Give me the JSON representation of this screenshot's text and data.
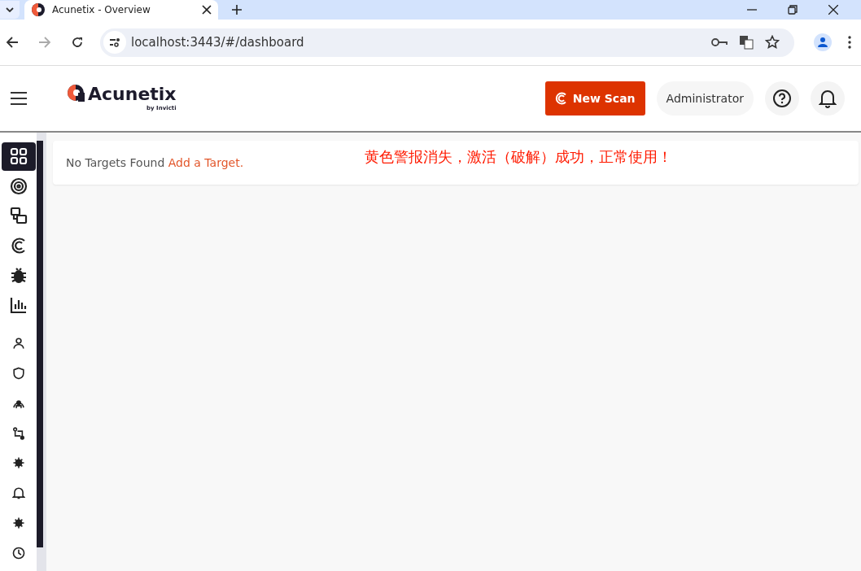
{
  "browser": {
    "tab": {
      "title": "Acunetix - Overview",
      "selected": true
    },
    "address": "localhost:3443/#/dashboard"
  },
  "header": {
    "logo": "Acunetix",
    "logo_sub": "by Invicti",
    "new_scan": "New Scan",
    "user": "Administrator"
  },
  "sidebar": {
    "items": [
      {
        "kind": "dashboard",
        "selected": true
      },
      {
        "kind": "target",
        "selected": false
      },
      {
        "kind": "groups",
        "selected": false
      },
      {
        "kind": "scan",
        "selected": false
      },
      {
        "kind": "bug",
        "selected": false
      },
      {
        "kind": "chart",
        "selected": false
      },
      {
        "kind": "user",
        "selected": false
      },
      {
        "kind": "shield",
        "selected": false
      },
      {
        "kind": "network",
        "selected": false
      },
      {
        "kind": "flow",
        "selected": false
      },
      {
        "kind": "gear",
        "selected": false
      },
      {
        "kind": "bell",
        "selected": false
      },
      {
        "kind": "gear",
        "selected": false
      },
      {
        "kind": "clock",
        "selected": false
      }
    ]
  },
  "notice": {
    "text": "No Targets Found",
    "link": "Add a Target."
  },
  "annotation": "黄色警报消失，激活（破解）成功，正常使用！"
}
